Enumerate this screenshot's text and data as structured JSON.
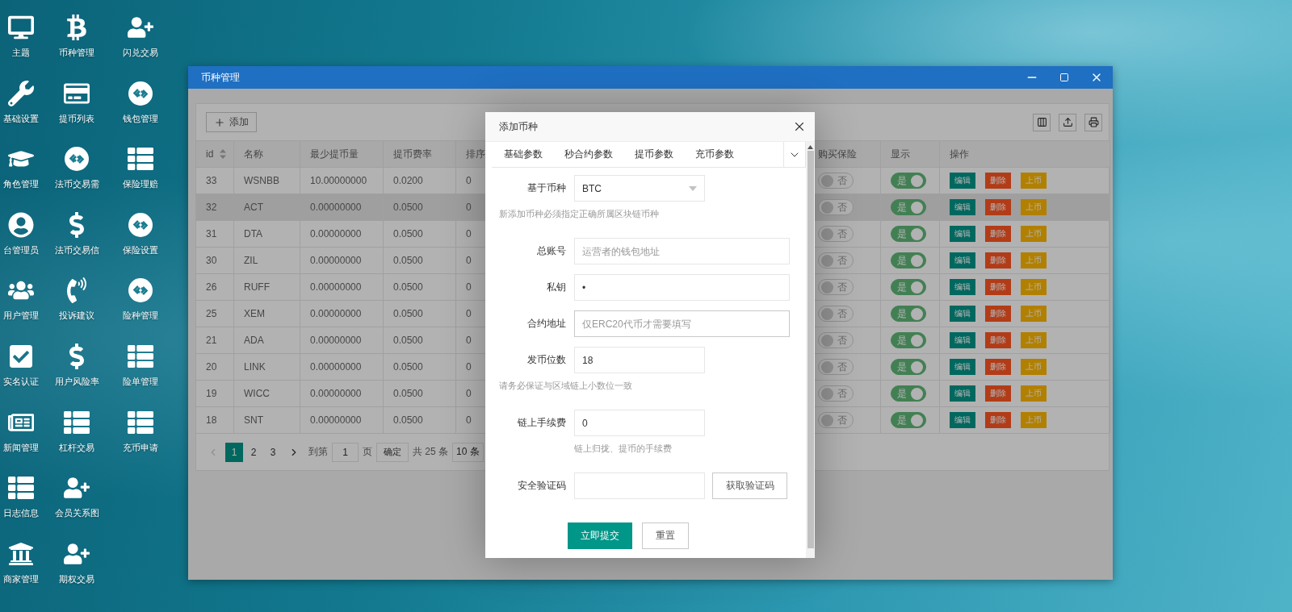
{
  "desktop": {
    "rows": [
      [
        {
          "label": "主题"
        },
        {
          "label": "币种管理"
        },
        {
          "label": "闪兑交易"
        }
      ],
      [
        {
          "label": "基础设置"
        },
        {
          "label": "提币列表"
        },
        {
          "label": "钱包管理"
        }
      ],
      [
        {
          "label": "角色管理"
        },
        {
          "label": "法币交易需"
        },
        {
          "label": "保险理赔"
        }
      ],
      [
        {
          "label": "台管理员"
        },
        {
          "label": "法币交易信"
        },
        {
          "label": "保险设置"
        }
      ],
      [
        {
          "label": "用户管理"
        },
        {
          "label": "投诉建议"
        },
        {
          "label": "险种管理"
        }
      ],
      [
        {
          "label": "实名认证"
        },
        {
          "label": "用户风险率"
        },
        {
          "label": "险单管理"
        }
      ],
      [
        {
          "label": "新闻管理"
        },
        {
          "label": "杠杆交易"
        },
        {
          "label": "充币申请"
        }
      ],
      [
        {
          "label": "日志信息"
        },
        {
          "label": "会员关系图"
        }
      ],
      [
        {
          "label": "商家管理"
        },
        {
          "label": "期权交易"
        }
      ]
    ]
  },
  "window": {
    "title": "币种管理"
  },
  "toolbar": {
    "add_button": "添加"
  },
  "table": {
    "columns": [
      "id",
      "名称",
      "最少提币量",
      "提币费率",
      "排序",
      "购买保险",
      "显示",
      "操作"
    ],
    "rows": [
      {
        "id": "33",
        "name": "WSNBB",
        "min": "10.00000000",
        "fee": "0.0200",
        "sort": "0",
        "insurance": {
          "label": "否",
          "on": false
        },
        "show": {
          "label": "是",
          "on": true
        },
        "actions": [
          "编辑",
          "删除",
          "上币"
        ],
        "hovered": false
      },
      {
        "id": "32",
        "name": "ACT",
        "min": "0.00000000",
        "fee": "0.0500",
        "sort": "0",
        "insurance": {
          "label": "否",
          "on": false
        },
        "show": {
          "label": "是",
          "on": true
        },
        "actions": [
          "编辑",
          "删除",
          "上币"
        ],
        "hovered": true
      },
      {
        "id": "31",
        "name": "DTA",
        "min": "0.00000000",
        "fee": "0.0500",
        "sort": "0",
        "insurance": {
          "label": "否",
          "on": false
        },
        "show": {
          "label": "是",
          "on": true
        },
        "actions": [
          "编辑",
          "删除",
          "上币"
        ],
        "hovered": false
      },
      {
        "id": "30",
        "name": "ZIL",
        "min": "0.00000000",
        "fee": "0.0500",
        "sort": "0",
        "insurance": {
          "label": "否",
          "on": false
        },
        "show": {
          "label": "是",
          "on": true
        },
        "actions": [
          "编辑",
          "删除",
          "上币"
        ],
        "hovered": false
      },
      {
        "id": "26",
        "name": "RUFF",
        "min": "0.00000000",
        "fee": "0.0500",
        "sort": "0",
        "insurance": {
          "label": "否",
          "on": false
        },
        "show": {
          "label": "是",
          "on": true
        },
        "actions": [
          "编辑",
          "删除",
          "上币"
        ],
        "hovered": false
      },
      {
        "id": "25",
        "name": "XEM",
        "min": "0.00000000",
        "fee": "0.0500",
        "sort": "0",
        "insurance": {
          "label": "否",
          "on": false
        },
        "show": {
          "label": "是",
          "on": true
        },
        "actions": [
          "编辑",
          "删除",
          "上币"
        ],
        "hovered": false
      },
      {
        "id": "21",
        "name": "ADA",
        "min": "0.00000000",
        "fee": "0.0500",
        "sort": "0",
        "insurance": {
          "label": "否",
          "on": false
        },
        "show": {
          "label": "是",
          "on": true
        },
        "actions": [
          "编辑",
          "删除",
          "上币"
        ],
        "hovered": false
      },
      {
        "id": "20",
        "name": "LINK",
        "min": "0.00000000",
        "fee": "0.0500",
        "sort": "0",
        "insurance": {
          "label": "否",
          "on": false
        },
        "show": {
          "label": "是",
          "on": true
        },
        "actions": [
          "编辑",
          "删除",
          "上币"
        ],
        "hovered": false
      },
      {
        "id": "19",
        "name": "WICC",
        "min": "0.00000000",
        "fee": "0.0500",
        "sort": "0",
        "insurance": {
          "label": "否",
          "on": false
        },
        "show": {
          "label": "是",
          "on": true
        },
        "actions": [
          "编辑",
          "删除",
          "上币"
        ],
        "hovered": false
      },
      {
        "id": "18",
        "name": "SNT",
        "min": "0.00000000",
        "fee": "0.0500",
        "sort": "0",
        "insurance": {
          "label": "否",
          "on": false
        },
        "show": {
          "label": "是",
          "on": true
        },
        "actions": [
          "编辑",
          "删除",
          "上币"
        ],
        "hovered": false
      }
    ]
  },
  "pagination": {
    "prev": {
      "disabled": true
    },
    "pages": [
      {
        "label": "1",
        "selected": true
      },
      {
        "label": "2",
        "selected": false
      },
      {
        "label": "3",
        "selected": false
      }
    ],
    "next": {
      "disabled": false
    },
    "goto_label": "到第",
    "goto_value": "1",
    "page_unit": "页",
    "confirm": "确定",
    "total": "共 25 条",
    "page_size": "10 条"
  },
  "modal": {
    "title": "添加币种",
    "tabs": [
      {
        "label": "基础参数"
      },
      {
        "label": "秒合约参数"
      },
      {
        "label": "提币参数"
      },
      {
        "label": "充币参数"
      }
    ],
    "form": [
      {
        "kind": "select",
        "label": "基于币种",
        "value": "BTC"
      },
      {
        "kind": "note",
        "text": "新添加币种必须指定正确所属区块链币种"
      },
      {
        "kind": "textbox",
        "label": "总账号",
        "placeholder": "运营者的钱包地址",
        "focused": false
      },
      {
        "kind": "textbox",
        "label": "私钥",
        "value": "•",
        "focused": false
      },
      {
        "kind": "textbox",
        "label": "合约地址",
        "placeholder": "仅ERC20代币才需要填写",
        "focused": true
      },
      {
        "kind": "numberbox",
        "label": "发币位数",
        "value": "18",
        "focused": false
      },
      {
        "kind": "note",
        "text": "请务必保证与区域链上小数位一致"
      },
      {
        "kind": "numberbox",
        "label": "链上手续费",
        "value": "0",
        "focused": false
      },
      {
        "kind": "help",
        "text": "链上归拢、提币的手续费"
      },
      {
        "kind": "code",
        "label": "安全验证码",
        "button": "获取验证码"
      }
    ],
    "buttons": [
      {
        "kind": "primary",
        "label": "立即提交"
      },
      {
        "kind": "default",
        "label": "重置"
      }
    ]
  }
}
